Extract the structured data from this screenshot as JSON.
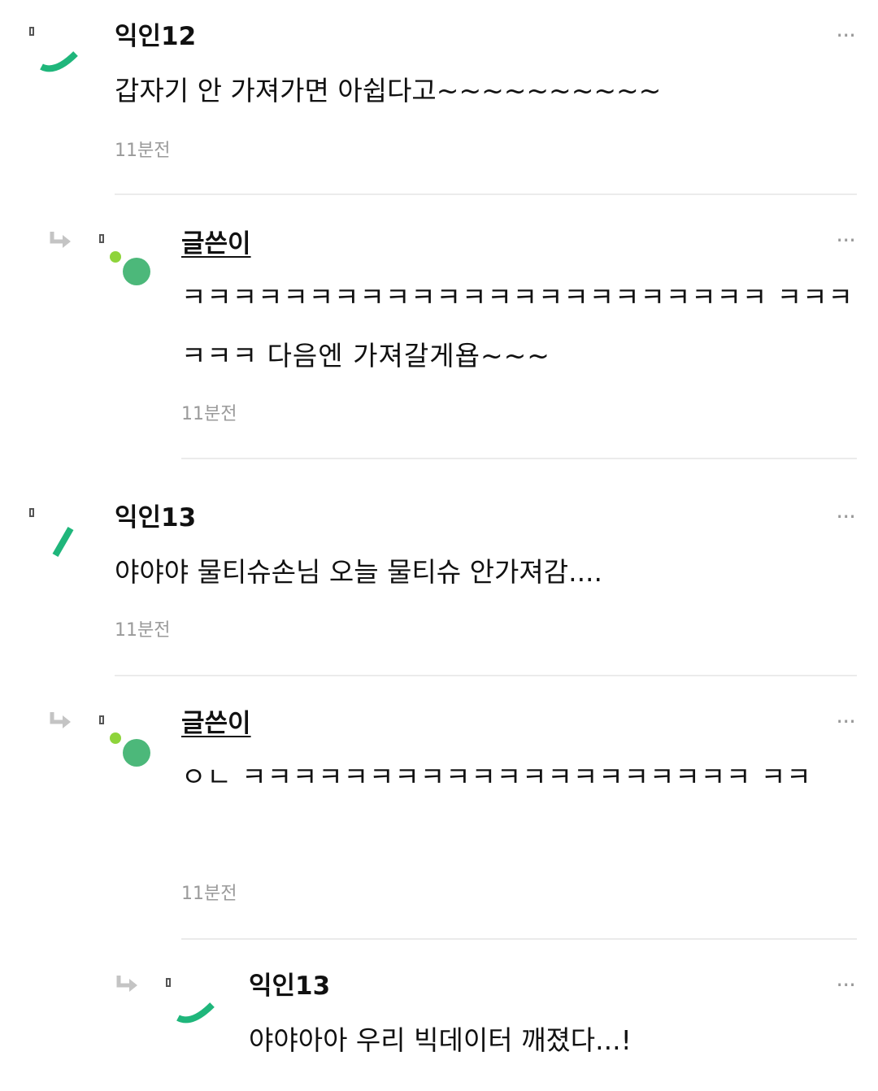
{
  "comments": [
    {
      "author": "익인12",
      "text": "갑자기 안 가져가면 아쉽다고~~~~~~~~~~",
      "time": "11분전",
      "more": "···",
      "accent": "#1fb67b"
    },
    {
      "author": "글쓴이",
      "text": "ㅋㅋㅋㅋㅋㅋㅋㅋㅋㅋㅋㅋㅋㅋㅋㅋㅋㅋㅋㅋㅋㅋㅋ ㅋㅋㅋㅋㅋㅋ 다음엔 가져갈게욥~~~",
      "time": "11분전",
      "more": "···",
      "is_op": true,
      "accent": "#4cb87a",
      "dot": "#8ed43b"
    },
    {
      "author": "익인13",
      "text": "야야야 물티슈손님 오늘 물티슈 안가져감....",
      "time": "11분전",
      "more": "···",
      "accent": "#1fb67b"
    },
    {
      "author": "글쓴이",
      "text": "ㅇㄴ ㅋㅋㅋㅋㅋㅋㅋㅋㅋㅋㅋㅋㅋㅋㅋㅋㅋㅋㅋㅋ ㅋㅋ",
      "time": "11분전",
      "more": "···",
      "is_op": true,
      "accent": "#4cb87a",
      "dot": "#8ed43b"
    },
    {
      "author": "익인13",
      "text": "야야아아 우리 빅데이터 깨졌다...!",
      "more": "···",
      "accent": "#1fb67b"
    }
  ],
  "icons": {
    "reply": "reply-arrow-icon",
    "badge": "badge-icon",
    "more": "more-options-icon"
  }
}
